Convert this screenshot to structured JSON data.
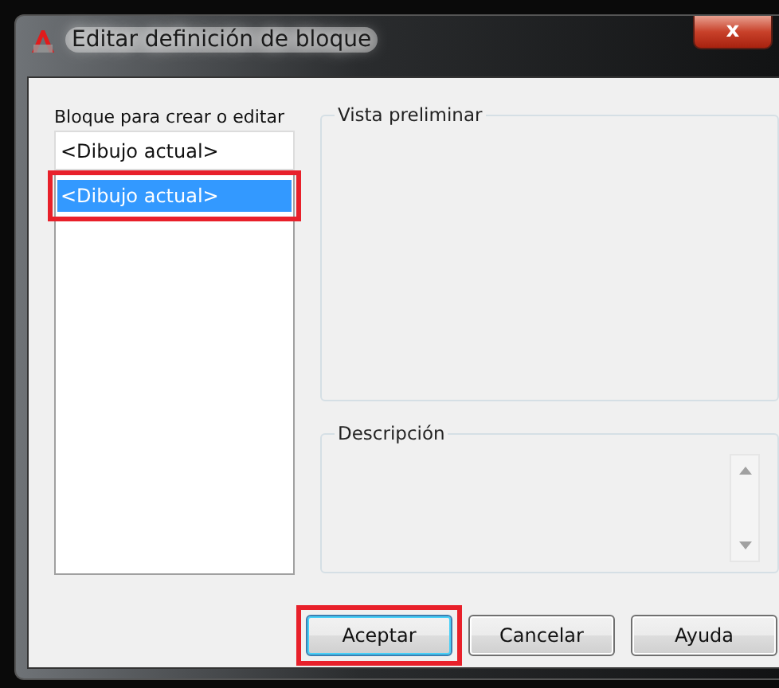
{
  "window": {
    "title": "Editar definición de bloque",
    "close": "x"
  },
  "block_list": {
    "label": "Bloque para crear o editar",
    "value": "<Dibujo actual>",
    "items": [
      {
        "text": "<Dibujo actual>",
        "selected": true,
        "highlighted": true
      }
    ]
  },
  "preview": {
    "title": "Vista preliminar"
  },
  "description": {
    "title": "Descripción"
  },
  "buttons": [
    {
      "label": "Aceptar",
      "default": true,
      "highlighted": true
    },
    {
      "label": "Cancelar",
      "default": false,
      "highlighted": false
    },
    {
      "label": "Ayuda",
      "default": false,
      "highlighted": false
    }
  ]
}
